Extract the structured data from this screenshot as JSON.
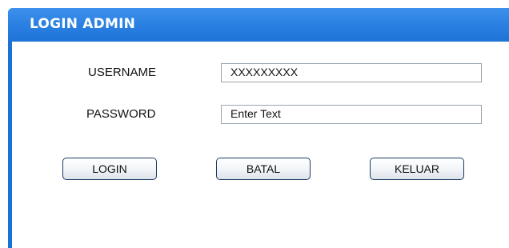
{
  "window": {
    "title": "LOGIN ADMIN"
  },
  "form": {
    "username_label": "USERNAME",
    "username_value": "XXXXXXXXX",
    "password_label": "PASSWORD",
    "password_placeholder": "Enter Text"
  },
  "buttons": {
    "login_label": "LOGIN",
    "batal_label": "BATAL",
    "keluar_label": "KELUAR"
  },
  "colors": {
    "titlebar": "#2a80e2",
    "title_text": "#ffffff",
    "button_border": "#1b3b63"
  }
}
